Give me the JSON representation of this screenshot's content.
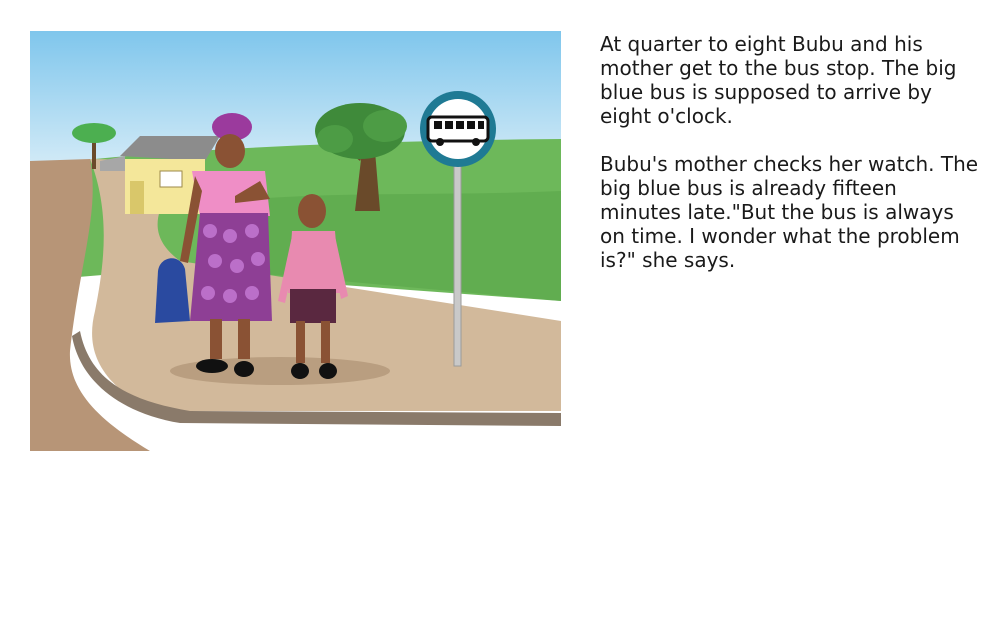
{
  "story": {
    "paragraphs": [
      "At quarter to eight Bubu and his mother get to the bus stop. The big blue bus is supposed to arrive by eight o'clock.",
      "Bubu's mother checks her watch. The big blue bus is already fifteen minutes late.\"But the bus is always on time. I wonder what the problem is?\" she says."
    ]
  },
  "illustration": {
    "colors": {
      "sky_top": "#7fc6ec",
      "sky_bottom": "#e8f4fa",
      "grass": "#6db85a",
      "road": "#d2b99b",
      "road_edge": "#8a7a6a",
      "sign_ring": "#1f7a94",
      "dress": "#8e3f95",
      "blouse": "#ef8ec6",
      "shirt": "#e88ab0",
      "shorts": "#5a2840",
      "bag": "#2a4aa0",
      "skin": "#8a5234"
    },
    "icons": [
      "bus-icon"
    ]
  }
}
